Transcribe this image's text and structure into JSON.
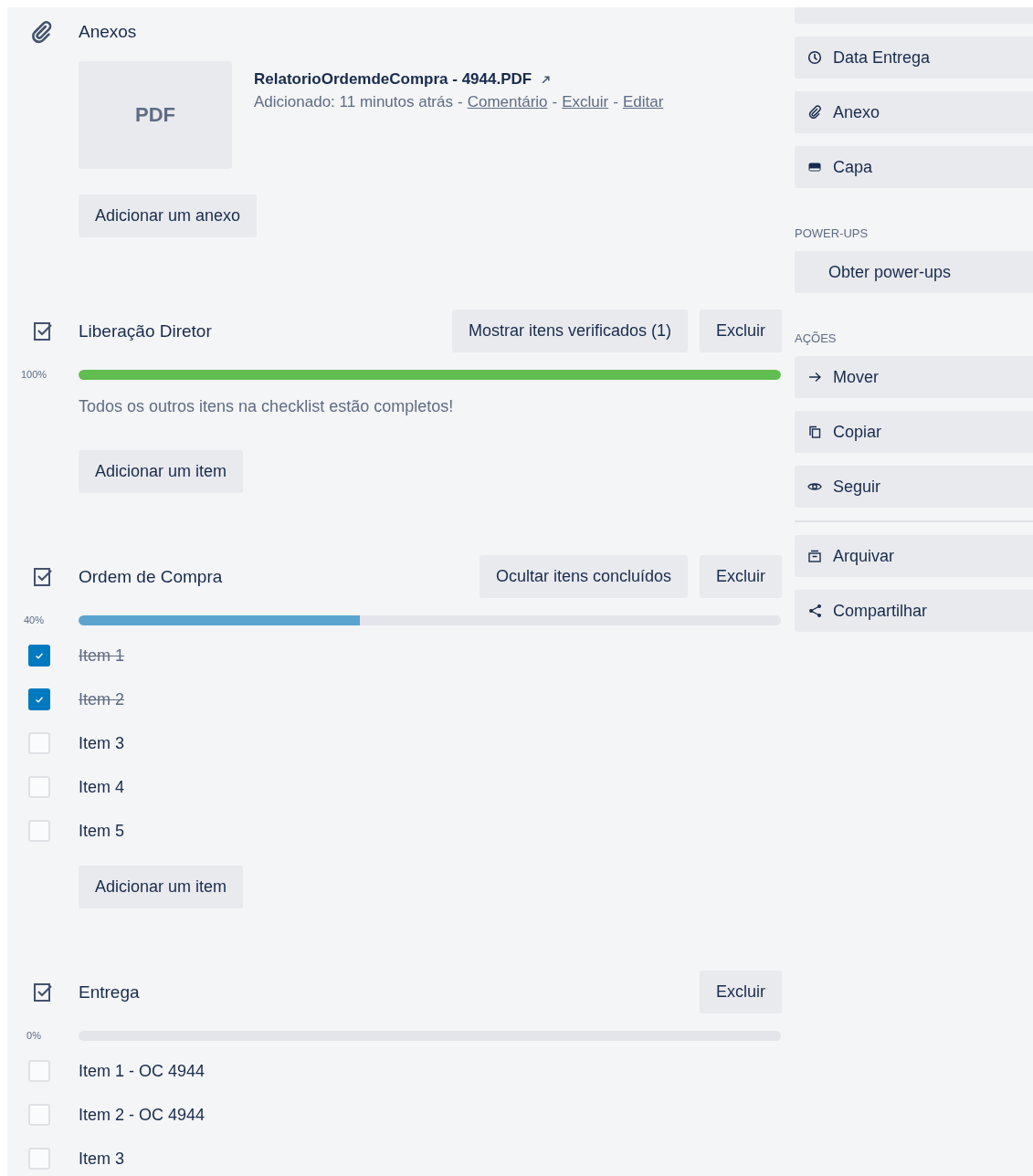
{
  "attachments": {
    "title": "Anexos",
    "files": [
      {
        "thumb": "PDF",
        "name": "RelatorioOrdemdeCompra - 4944.PDF",
        "added": "Adicionado: 11 minutos atrás",
        "separator": "-",
        "links": [
          "Comentário",
          "Excluir",
          "Editar"
        ]
      }
    ],
    "add_button": "Adicionar um anexo"
  },
  "checklists": [
    {
      "title": "Liberação Diretor",
      "buttons": [
        "Mostrar itens verificados (1)",
        "Excluir"
      ],
      "percent": "100%",
      "level": 1,
      "message": "Todos os outros itens na checklist estão completos!",
      "add_button": "Adicionar um item"
    },
    {
      "title": "Ordem de Compra",
      "buttons": [
        "Ocultar itens concluídos",
        "Excluir"
      ],
      "percent": "40%",
      "level": 0.4,
      "items": [
        {
          "label": "Item 1",
          "checked": true
        },
        {
          "label": "Item 2",
          "checked": true
        },
        {
          "label": "Item 3",
          "checked": false
        },
        {
          "label": "Item 4",
          "checked": false
        },
        {
          "label": "Item 5",
          "checked": false
        }
      ],
      "add_button": "Adicionar um item"
    },
    {
      "title": "Entrega",
      "buttons": [
        "Excluir"
      ],
      "percent": "0%",
      "items": [
        {
          "label": "Item 1 - OC 4944",
          "checked": false
        },
        {
          "label": "Item 2 - OC 4944",
          "checked": false
        },
        {
          "label": "Item 3",
          "checked": false
        }
      ]
    }
  ],
  "sidebar": {
    "sections": [
      {
        "divider": false,
        "items": [
          {
            "kind": "partial"
          },
          {
            "kind": "clock",
            "label": "Data Entrega"
          },
          {
            "kind": "paperclip",
            "label": "Anexo"
          },
          {
            "kind": "card",
            "label": "Capa"
          }
        ]
      },
      {
        "divider": false,
        "heading": "POWER-UPS",
        "items": [
          {
            "kind": "plain",
            "label": "Obter power-ups"
          }
        ]
      },
      {
        "divider": false,
        "heading": "AÇÕES",
        "items": [
          {
            "kind": "arrow",
            "label": "Mover"
          },
          {
            "kind": "copy",
            "label": "Copiar"
          },
          {
            "kind": "eye",
            "label": "Seguir"
          }
        ]
      },
      {
        "divider": true,
        "items": [
          {
            "kind": "archive",
            "label": "Arquivar"
          },
          {
            "kind": "share",
            "label": "Compartilhar"
          }
        ]
      }
    ]
  }
}
